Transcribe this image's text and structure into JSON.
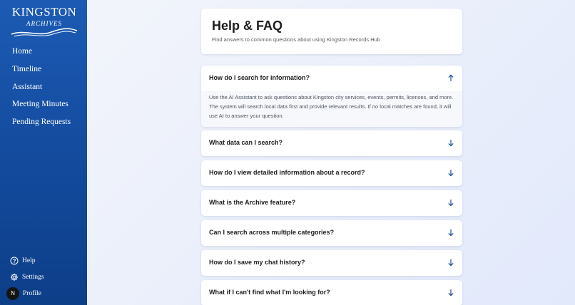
{
  "logo": {
    "title": "KINGSTON",
    "subtitle": "ARCHIVES"
  },
  "nav": {
    "items": [
      {
        "label": "Home"
      },
      {
        "label": "Timeline"
      },
      {
        "label": "Assistant"
      },
      {
        "label": "Meeting Minutes"
      },
      {
        "label": "Pending Requests"
      }
    ]
  },
  "bottom_nav": {
    "help": "Help",
    "settings": "Settings",
    "profile": "Profile",
    "avatar_initial": "N"
  },
  "header": {
    "title": "Help & FAQ",
    "subtitle": "Find answers to common questions about using Kingston Records Hub"
  },
  "faqs": [
    {
      "question": "How do I search for information?",
      "answer": "Use the AI Assistant to ask questions about Kingston city services, events, permits, licenses, and more. The system will search local data first and provide relevant results. If no local matches are found, it will use AI to answer your question.",
      "expanded": true
    },
    {
      "question": "What data can I search?",
      "expanded": false
    },
    {
      "question": "How do I view detailed information about a record?",
      "expanded": false
    },
    {
      "question": "What is the Archive feature?",
      "expanded": false
    },
    {
      "question": "Can I search across multiple categories?",
      "expanded": false
    },
    {
      "question": "How do I save my chat history?",
      "expanded": false
    },
    {
      "question": "What if I can't find what I'm looking for?",
      "expanded": false
    }
  ],
  "colors": {
    "sidebar": "#1c5bb4",
    "arrow": "#1d4f9a"
  },
  "icons": {
    "expanded": "arrow-up-icon",
    "collapsed": "arrow-down-icon",
    "help": "help-circle-icon",
    "settings": "gear-icon"
  }
}
